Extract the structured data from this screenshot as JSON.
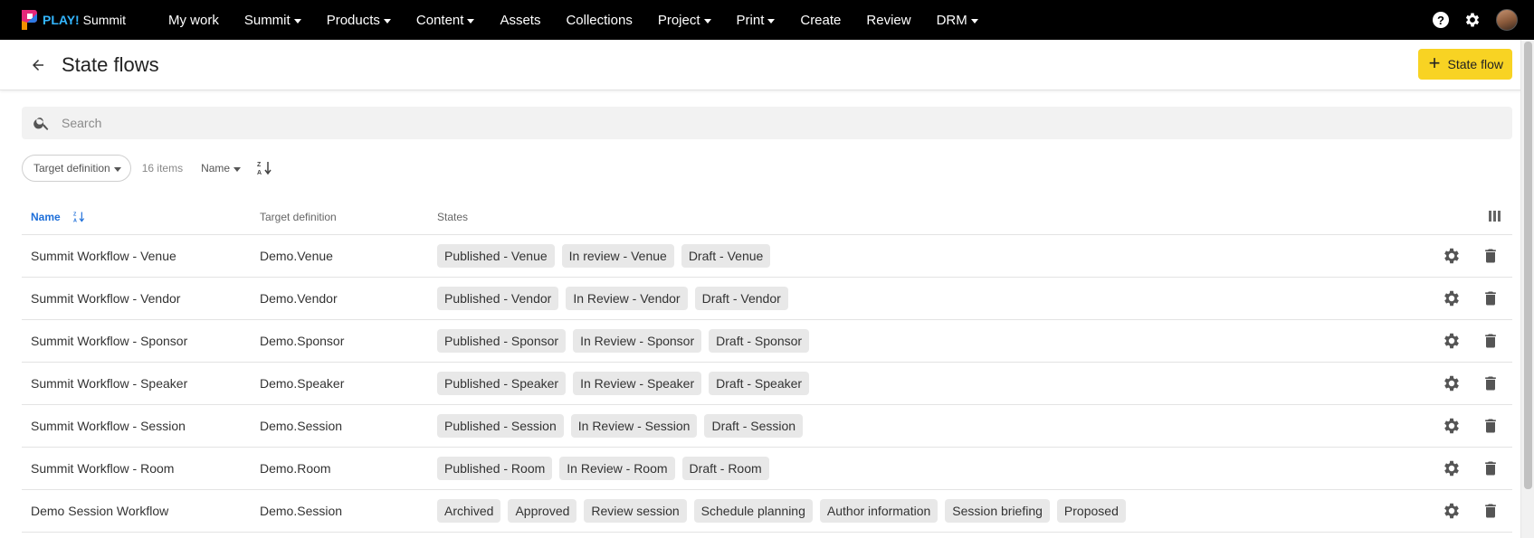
{
  "app": {
    "brand_prefix": "PLAY!",
    "brand_name": "Summit"
  },
  "nav": {
    "items": [
      {
        "label": "My work",
        "dropdown": false
      },
      {
        "label": "Summit",
        "dropdown": true
      },
      {
        "label": "Products",
        "dropdown": true
      },
      {
        "label": "Content",
        "dropdown": true
      },
      {
        "label": "Assets",
        "dropdown": false
      },
      {
        "label": "Collections",
        "dropdown": false
      },
      {
        "label": "Project",
        "dropdown": true
      },
      {
        "label": "Print",
        "dropdown": true
      },
      {
        "label": "Create",
        "dropdown": false
      },
      {
        "label": "Review",
        "dropdown": false
      },
      {
        "label": "DRM",
        "dropdown": true
      }
    ],
    "right_icons": [
      "help-icon",
      "settings-icon",
      "user-avatar"
    ]
  },
  "header": {
    "title": "State flows",
    "add_button_label": "State flow"
  },
  "search": {
    "placeholder": "Search",
    "value": ""
  },
  "filters": {
    "target_filter_label": "Target definition",
    "items_count": "16 items",
    "sort_field": "Name"
  },
  "table": {
    "columns": {
      "name": "Name",
      "target": "Target definition",
      "states": "States"
    },
    "rows": [
      {
        "name": "Summit Workflow - Venue",
        "target": "Demo.Venue",
        "states": [
          "Published - Venue",
          "In review - Venue",
          "Draft - Venue"
        ]
      },
      {
        "name": "Summit Workflow - Vendor",
        "target": "Demo.Vendor",
        "states": [
          "Published - Vendor",
          "In Review - Vendor",
          "Draft - Vendor"
        ]
      },
      {
        "name": "Summit Workflow - Sponsor",
        "target": "Demo.Sponsor",
        "states": [
          "Published - Sponsor",
          "In Review - Sponsor",
          "Draft - Sponsor"
        ]
      },
      {
        "name": "Summit Workflow - Speaker",
        "target": "Demo.Speaker",
        "states": [
          "Published - Speaker",
          "In Review - Speaker",
          "Draft - Speaker"
        ]
      },
      {
        "name": "Summit Workflow - Session",
        "target": "Demo.Session",
        "states": [
          "Published - Session",
          "In Review - Session",
          "Draft - Session"
        ]
      },
      {
        "name": "Summit Workflow - Room",
        "target": "Demo.Room",
        "states": [
          "Published - Room",
          "In Review - Room",
          "Draft - Room"
        ]
      },
      {
        "name": "Demo Session Workflow",
        "target": "Demo.Session",
        "states": [
          "Archived",
          "Approved",
          "Review session",
          "Schedule planning",
          "Author information",
          "Session briefing",
          "Proposed"
        ]
      }
    ]
  },
  "colors": {
    "nav_bg": "#000000",
    "accent_yellow": "#f8d323",
    "link_blue": "#1e6fd9",
    "brand_blue": "#33b6ff",
    "tag_bg": "#e8e8e8"
  }
}
